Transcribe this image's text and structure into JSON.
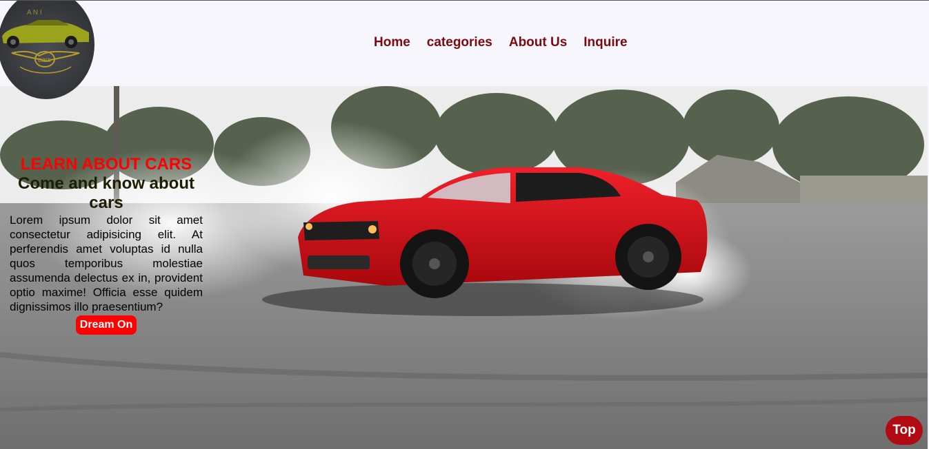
{
  "logo": {
    "lettering_top": "A N I",
    "lettering_badge": "cars",
    "icon": "car-logo-icon"
  },
  "nav": {
    "items": [
      {
        "label": "Home"
      },
      {
        "label": "categories"
      },
      {
        "label": "About Us"
      },
      {
        "label": "Inquire"
      }
    ],
    "color": "#7a0a0e"
  },
  "hero": {
    "kicker": "LEARN ABOUT CARS",
    "title": "Come and know about cars",
    "body": "Lorem ipsum dolor sit amet consectetur adipisicing elit. At perferendis amet voluptas id nulla quos temporibus molestiae assumenda delectus ex in, provident optio maxime! Officia esse quidem dignissimos illo praesentium?",
    "cta_label": "Dream On",
    "image_subject": "red-sports-car-drifting-icon"
  },
  "top_button": {
    "label": "Top"
  },
  "colors": {
    "accent": "#ff0000",
    "nav": "#7a0a0e",
    "top_button": "#b00a12"
  }
}
